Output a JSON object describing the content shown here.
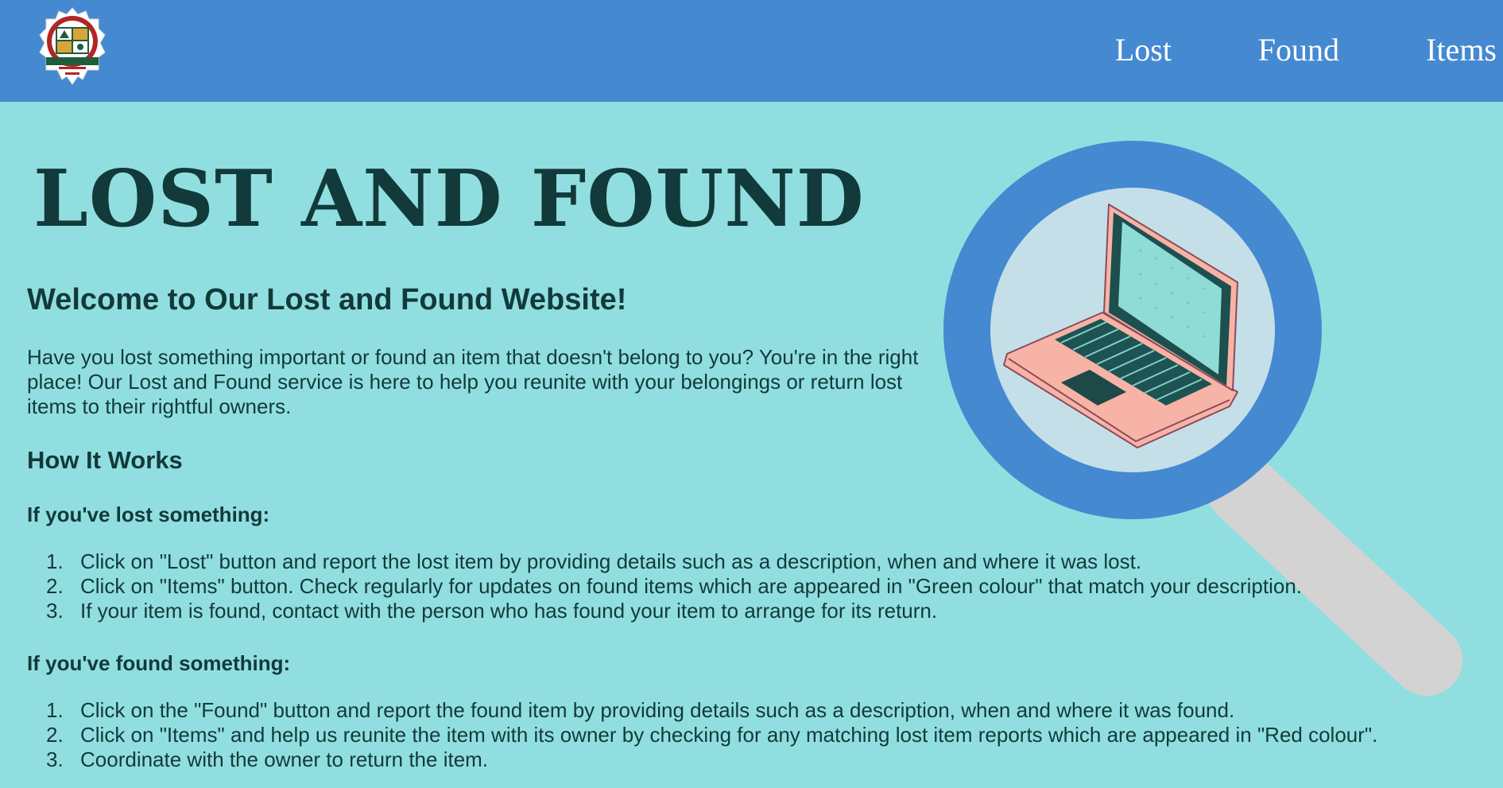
{
  "header": {
    "logo_icon": "institute-crest-logo",
    "nav": [
      {
        "label": "Lost"
      },
      {
        "label": "Found"
      },
      {
        "label": "Items"
      }
    ]
  },
  "hero": {
    "title": "LOST AND FOUND",
    "illustration_icon": "magnifier-laptop-illustration"
  },
  "content": {
    "welcome": "Welcome to Our Lost and Found Website!",
    "intro": "Have you lost something important or found an item that doesn't belong to you? You're in the right place! Our Lost and Found service is here to help you reunite with your belongings or return lost items to their rightful owners.",
    "how_heading": "How It Works",
    "lost": {
      "heading": "If you've lost something:",
      "steps": [
        {
          "num": "1.",
          "text": "Click on \"Lost\" button and report the lost item by providing details such as a description, when and where it was lost."
        },
        {
          "num": "2.",
          "text": "Click on \"Items\" button. Check regularly for updates on found items which are appeared in \"Green colour\" that match your description."
        },
        {
          "num": "3.",
          "text": "If your item is found, contact with the person who has found your item to arrange for its return."
        }
      ]
    },
    "found": {
      "heading": "If you've found something:",
      "steps": [
        {
          "num": "1.",
          "text": "Click on the \"Found\" button and report the found item by providing details such as a description, when and where it was found."
        },
        {
          "num": "2.",
          "text": "Click on \"Items\" and help us reunite the item with its owner by checking for any matching lost item reports which are appeared in \"Red colour\"."
        },
        {
          "num": "3.",
          "text": "Coordinate with the owner to return the item."
        }
      ]
    }
  },
  "colors": {
    "header": "#4589d1",
    "background": "#91dee0",
    "text": "#123a3a",
    "lens_ring": "#4589d1",
    "lens_glass": "#c5dfe8",
    "handle": "#d3d3d3",
    "laptop_body": "#f7b3a6",
    "screen": "#8fdcd6",
    "dark": "#133a3a"
  }
}
